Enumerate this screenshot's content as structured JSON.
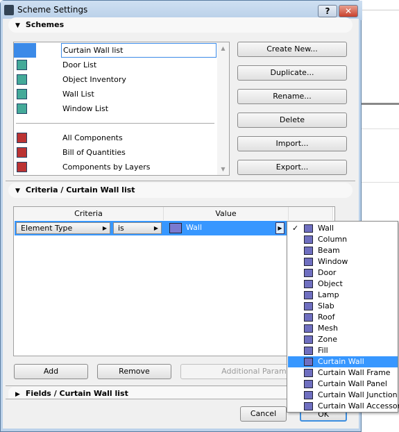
{
  "window": {
    "title": "Scheme Settings",
    "help_label": "?",
    "close_label": "✕"
  },
  "schemes": {
    "header": "Schemes",
    "items": [
      {
        "label": "Curtain Wall list",
        "selected": true,
        "icon": "element-scheme-icon"
      },
      {
        "label": "Door List",
        "icon": "element-scheme-icon"
      },
      {
        "label": "Object Inventory",
        "icon": "element-scheme-icon"
      },
      {
        "label": "Wall List",
        "icon": "element-scheme-icon"
      },
      {
        "label": "Window List",
        "icon": "element-scheme-icon"
      },
      {
        "label": "All Components",
        "icon": "component-scheme-icon"
      },
      {
        "label": "Bill of Quantities",
        "icon": "component-scheme-icon"
      },
      {
        "label": "Components by Layers",
        "icon": "component-scheme-icon"
      }
    ],
    "buttons": {
      "create_new": "Create New...",
      "duplicate": "Duplicate...",
      "rename": "Rename...",
      "delete": "Delete",
      "import": "Import...",
      "export": "Export..."
    }
  },
  "criteria": {
    "header": "Criteria /  Curtain Wall list",
    "columns": [
      "Criteria",
      "Value"
    ],
    "row": {
      "criterion": "Element Type",
      "operator": "is",
      "value": "Wall"
    },
    "buttons": {
      "add": "Add",
      "remove": "Remove",
      "additional": "Additional Parameters"
    }
  },
  "fields": {
    "header": "Fields /  Curtain Wall list"
  },
  "footer": {
    "cancel": "Cancel",
    "ok": "OK"
  },
  "menu": {
    "checked": "Wall",
    "highlighted": "Curtain Wall",
    "items": [
      "Wall",
      "Column",
      "Beam",
      "Window",
      "Door",
      "Object",
      "Lamp",
      "Slab",
      "Roof",
      "Mesh",
      "Zone",
      "Fill",
      "Curtain Wall",
      "Curtain Wall Frame",
      "Curtain Wall Panel",
      "Curtain Wall Junction",
      "Curtain Wall Accessory"
    ]
  },
  "colors": {
    "selection": "#3797ff",
    "title_bar": "#bcd2ea"
  }
}
